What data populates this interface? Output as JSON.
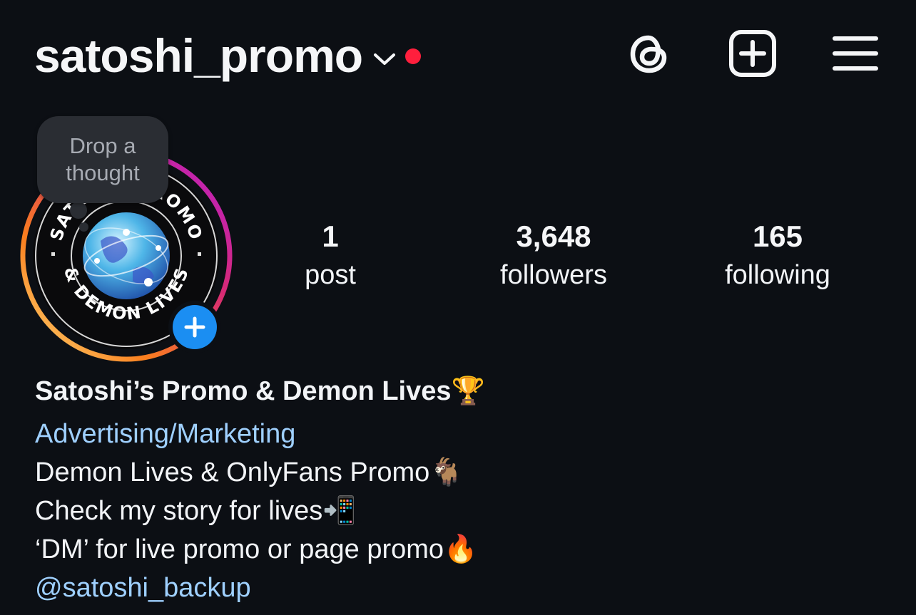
{
  "header": {
    "username": "satoshi_promo",
    "icons": [
      "chevron-down-icon",
      "notification-dot",
      "threads-icon",
      "create-post-icon",
      "menu-icon"
    ],
    "notification_dot_color": "#ff1f3d"
  },
  "profile": {
    "note_text_line1": "Drop a",
    "note_text_line2": "thought",
    "avatar_text_top": "SATOSHI PROMO",
    "avatar_text_bottom": "& DEMON LIVES",
    "story_ring_colors": [
      "#feda75",
      "#fa7e1e",
      "#d62976",
      "#c13584"
    ],
    "add_story_color": "#1b8ef2"
  },
  "stats": {
    "posts_count": "1",
    "posts_label": "post",
    "followers_count": "3,648",
    "followers_label": "followers",
    "following_count": "165",
    "following_label": "following"
  },
  "bio": {
    "name": "Satoshi’s Promo & Demon Lives🏆",
    "category": "Advertising/Marketing",
    "lines": [
      "Demon Lives & OnlyFans Promo🐐",
      "Check my story for lives📲",
      "‘DM’ for live promo or page promo🔥"
    ],
    "link": "@satoshi_backup",
    "link_color": "#9fd0ff"
  }
}
